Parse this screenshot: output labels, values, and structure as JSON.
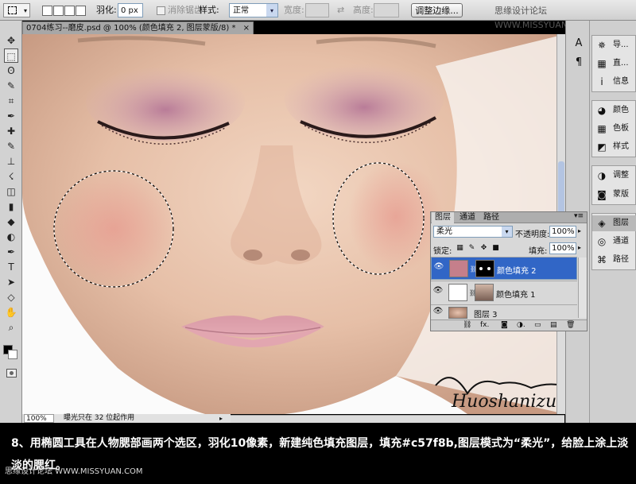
{
  "options_bar": {
    "feather_label": "羽化:",
    "feather_value": "0 px",
    "antialias_label": "消除锯齿",
    "style_label": "样式:",
    "style_value": "正常",
    "width_label": "宽度:",
    "height_label": "高度:",
    "refine_edge_button": "调整边缘...",
    "watermark": "思缘设计论坛 WWW.MISSYUAN.COM"
  },
  "document": {
    "tab_title": "0704练习--磨皮.psd @ 100% (颜色填充 2, 图层蒙版/8) *",
    "close_glyph": "×",
    "zoom": "100%",
    "status_message": "曝光只在 32 位起作用",
    "signature": "Huoshanizuo"
  },
  "toolbox": {
    "icons": [
      "move-icon",
      "rect-marquee-icon",
      "lasso-icon",
      "quick-select-icon",
      "crop-icon",
      "eyedropper-icon",
      "healing-brush-icon",
      "brush-icon",
      "clone-stamp-icon",
      "history-brush-icon",
      "eraser-icon",
      "gradient-icon",
      "blur-icon",
      "dodge-icon",
      "pen-icon",
      "type-icon",
      "path-select-icon",
      "shape-icon",
      "hand-icon",
      "zoom-icon"
    ],
    "glyphs": [
      "✥",
      "⬚",
      "ʘ",
      "✎",
      "⌗",
      "✒",
      "✚",
      "✎",
      "⊥",
      "☇",
      "◫",
      "▮",
      "◆",
      "◐",
      "✒",
      "T",
      "➤",
      "◇",
      "✋",
      "⌕"
    ]
  },
  "dock_icons": [
    {
      "icon": "character-icon",
      "glyph": "A"
    },
    {
      "icon": "paragraph-icon",
      "glyph": "¶"
    }
  ],
  "dock_panels": {
    "group1": [
      {
        "icon": "navigator-icon",
        "glyph": "✵",
        "label": "导..."
      },
      {
        "icon": "histogram-icon",
        "glyph": "▦",
        "label": "直..."
      },
      {
        "icon": "info-icon",
        "glyph": "i",
        "label": "信息"
      }
    ],
    "group2": [
      {
        "icon": "color-icon",
        "glyph": "◕",
        "label": "颜色"
      },
      {
        "icon": "swatches-icon",
        "glyph": "▦",
        "label": "色板"
      },
      {
        "icon": "styles-icon",
        "glyph": "◩",
        "label": "样式"
      }
    ],
    "group3": [
      {
        "icon": "adjustments-icon",
        "glyph": "◑",
        "label": "调整"
      },
      {
        "icon": "masks-icon",
        "glyph": "◙",
        "label": "蒙版"
      }
    ],
    "group4": [
      {
        "icon": "layers-icon",
        "glyph": "◈",
        "label": "图层"
      },
      {
        "icon": "channels-icon",
        "glyph": "◎",
        "label": "通道"
      },
      {
        "icon": "paths-icon",
        "glyph": "⌘",
        "label": "路径"
      }
    ]
  },
  "layers_panel": {
    "tabs": [
      "图层",
      "通道",
      "路径"
    ],
    "menu_glyph": "▾≡",
    "blend_mode": "柔光",
    "opacity_label": "不透明度:",
    "opacity_value": "100%",
    "lock_label": "锁定:",
    "fill_label": "填充:",
    "fill_value": "100%",
    "layers": [
      {
        "name": "颜色填充 2",
        "selected": true,
        "fill_color": "#c57f8b"
      },
      {
        "name": "颜色填充 1",
        "selected": false,
        "fill_color": "#ffffff"
      },
      {
        "name": "图层 3",
        "selected": false
      }
    ],
    "footer_glyphs": [
      "⛓",
      "fx.",
      "◙",
      "◑.",
      "▭",
      "▤",
      "🗑"
    ]
  },
  "caption": {
    "text": "8、用椭圆工具在人物腮部画两个选区，羽化10像素，新建纯色填充图层，填充#c57f8b,图层模式为“柔光”，给脸上涂上淡淡的腮红。",
    "watermark": "思缘设计论坛 WWW.MISSYUAN.COM"
  },
  "colors": {
    "fill_color": "#c57f8b",
    "selection_blue": "#3166c6"
  }
}
